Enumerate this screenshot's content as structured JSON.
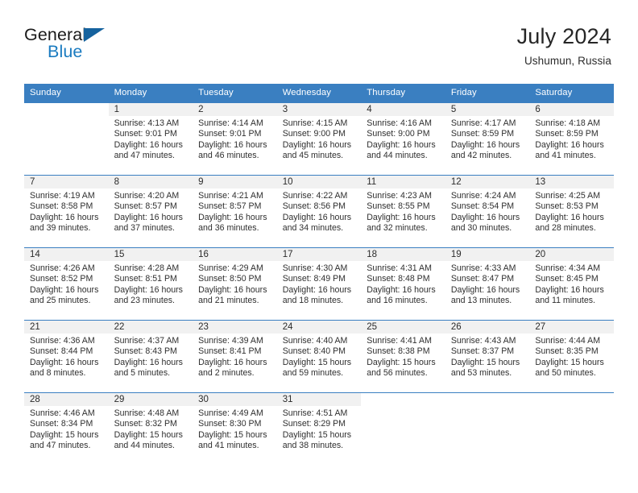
{
  "brand": {
    "word1": "General",
    "word2": "Blue",
    "triangle_color": "#15629E",
    "blue": "#1A7BC0"
  },
  "header": {
    "title": "July 2024",
    "location": "Ushumun, Russia"
  },
  "theme": {
    "header_bg": "#3A7FC1",
    "daynum_band": "#F1F1F1",
    "text": "#2F2F2F"
  },
  "weekday_headers": [
    "Sunday",
    "Monday",
    "Tuesday",
    "Wednesday",
    "Thursday",
    "Friday",
    "Saturday"
  ],
  "labels": {
    "sunrise": "Sunrise:",
    "sunset": "Sunset:",
    "daylight": "Daylight:"
  },
  "weeks": [
    [
      {
        "day": ""
      },
      {
        "day": "1",
        "sunrise": "4:13 AM",
        "sunset": "9:01 PM",
        "daylight": "16 hours and 47 minutes.",
        "info": "Sunrise: 4:13 AM\nSunset: 9:01 PM\nDaylight: 16 hours\nand 47 minutes."
      },
      {
        "day": "2",
        "sunrise": "4:14 AM",
        "sunset": "9:01 PM",
        "daylight": "16 hours and 46 minutes.",
        "info": "Sunrise: 4:14 AM\nSunset: 9:01 PM\nDaylight: 16 hours\nand 46 minutes."
      },
      {
        "day": "3",
        "sunrise": "4:15 AM",
        "sunset": "9:00 PM",
        "daylight": "16 hours and 45 minutes.",
        "info": "Sunrise: 4:15 AM\nSunset: 9:00 PM\nDaylight: 16 hours\nand 45 minutes."
      },
      {
        "day": "4",
        "sunrise": "4:16 AM",
        "sunset": "9:00 PM",
        "daylight": "16 hours and 44 minutes.",
        "info": "Sunrise: 4:16 AM\nSunset: 9:00 PM\nDaylight: 16 hours\nand 44 minutes."
      },
      {
        "day": "5",
        "sunrise": "4:17 AM",
        "sunset": "8:59 PM",
        "daylight": "16 hours and 42 minutes.",
        "info": "Sunrise: 4:17 AM\nSunset: 8:59 PM\nDaylight: 16 hours\nand 42 minutes."
      },
      {
        "day": "6",
        "sunrise": "4:18 AM",
        "sunset": "8:59 PM",
        "daylight": "16 hours and 41 minutes.",
        "info": "Sunrise: 4:18 AM\nSunset: 8:59 PM\nDaylight: 16 hours\nand 41 minutes."
      }
    ],
    [
      {
        "day": "7",
        "sunrise": "4:19 AM",
        "sunset": "8:58 PM",
        "daylight": "16 hours and 39 minutes.",
        "info": "Sunrise: 4:19 AM\nSunset: 8:58 PM\nDaylight: 16 hours\nand 39 minutes."
      },
      {
        "day": "8",
        "sunrise": "4:20 AM",
        "sunset": "8:57 PM",
        "daylight": "16 hours and 37 minutes.",
        "info": "Sunrise: 4:20 AM\nSunset: 8:57 PM\nDaylight: 16 hours\nand 37 minutes."
      },
      {
        "day": "9",
        "sunrise": "4:21 AM",
        "sunset": "8:57 PM",
        "daylight": "16 hours and 36 minutes.",
        "info": "Sunrise: 4:21 AM\nSunset: 8:57 PM\nDaylight: 16 hours\nand 36 minutes."
      },
      {
        "day": "10",
        "sunrise": "4:22 AM",
        "sunset": "8:56 PM",
        "daylight": "16 hours and 34 minutes.",
        "info": "Sunrise: 4:22 AM\nSunset: 8:56 PM\nDaylight: 16 hours\nand 34 minutes."
      },
      {
        "day": "11",
        "sunrise": "4:23 AM",
        "sunset": "8:55 PM",
        "daylight": "16 hours and 32 minutes.",
        "info": "Sunrise: 4:23 AM\nSunset: 8:55 PM\nDaylight: 16 hours\nand 32 minutes."
      },
      {
        "day": "12",
        "sunrise": "4:24 AM",
        "sunset": "8:54 PM",
        "daylight": "16 hours and 30 minutes.",
        "info": "Sunrise: 4:24 AM\nSunset: 8:54 PM\nDaylight: 16 hours\nand 30 minutes."
      },
      {
        "day": "13",
        "sunrise": "4:25 AM",
        "sunset": "8:53 PM",
        "daylight": "16 hours and 28 minutes.",
        "info": "Sunrise: 4:25 AM\nSunset: 8:53 PM\nDaylight: 16 hours\nand 28 minutes."
      }
    ],
    [
      {
        "day": "14",
        "sunrise": "4:26 AM",
        "sunset": "8:52 PM",
        "daylight": "16 hours and 25 minutes.",
        "info": "Sunrise: 4:26 AM\nSunset: 8:52 PM\nDaylight: 16 hours\nand 25 minutes."
      },
      {
        "day": "15",
        "sunrise": "4:28 AM",
        "sunset": "8:51 PM",
        "daylight": "16 hours and 23 minutes.",
        "info": "Sunrise: 4:28 AM\nSunset: 8:51 PM\nDaylight: 16 hours\nand 23 minutes."
      },
      {
        "day": "16",
        "sunrise": "4:29 AM",
        "sunset": "8:50 PM",
        "daylight": "16 hours and 21 minutes.",
        "info": "Sunrise: 4:29 AM\nSunset: 8:50 PM\nDaylight: 16 hours\nand 21 minutes."
      },
      {
        "day": "17",
        "sunrise": "4:30 AM",
        "sunset": "8:49 PM",
        "daylight": "16 hours and 18 minutes.",
        "info": "Sunrise: 4:30 AM\nSunset: 8:49 PM\nDaylight: 16 hours\nand 18 minutes."
      },
      {
        "day": "18",
        "sunrise": "4:31 AM",
        "sunset": "8:48 PM",
        "daylight": "16 hours and 16 minutes.",
        "info": "Sunrise: 4:31 AM\nSunset: 8:48 PM\nDaylight: 16 hours\nand 16 minutes."
      },
      {
        "day": "19",
        "sunrise": "4:33 AM",
        "sunset": "8:47 PM",
        "daylight": "16 hours and 13 minutes.",
        "info": "Sunrise: 4:33 AM\nSunset: 8:47 PM\nDaylight: 16 hours\nand 13 minutes."
      },
      {
        "day": "20",
        "sunrise": "4:34 AM",
        "sunset": "8:45 PM",
        "daylight": "16 hours and 11 minutes.",
        "info": "Sunrise: 4:34 AM\nSunset: 8:45 PM\nDaylight: 16 hours\nand 11 minutes."
      }
    ],
    [
      {
        "day": "21",
        "sunrise": "4:36 AM",
        "sunset": "8:44 PM",
        "daylight": "16 hours and 8 minutes.",
        "info": "Sunrise: 4:36 AM\nSunset: 8:44 PM\nDaylight: 16 hours\nand 8 minutes."
      },
      {
        "day": "22",
        "sunrise": "4:37 AM",
        "sunset": "8:43 PM",
        "daylight": "16 hours and 5 minutes.",
        "info": "Sunrise: 4:37 AM\nSunset: 8:43 PM\nDaylight: 16 hours\nand 5 minutes."
      },
      {
        "day": "23",
        "sunrise": "4:39 AM",
        "sunset": "8:41 PM",
        "daylight": "16 hours and 2 minutes.",
        "info": "Sunrise: 4:39 AM\nSunset: 8:41 PM\nDaylight: 16 hours\nand 2 minutes."
      },
      {
        "day": "24",
        "sunrise": "4:40 AM",
        "sunset": "8:40 PM",
        "daylight": "15 hours and 59 minutes.",
        "info": "Sunrise: 4:40 AM\nSunset: 8:40 PM\nDaylight: 15 hours\nand 59 minutes."
      },
      {
        "day": "25",
        "sunrise": "4:41 AM",
        "sunset": "8:38 PM",
        "daylight": "15 hours and 56 minutes.",
        "info": "Sunrise: 4:41 AM\nSunset: 8:38 PM\nDaylight: 15 hours\nand 56 minutes."
      },
      {
        "day": "26",
        "sunrise": "4:43 AM",
        "sunset": "8:37 PM",
        "daylight": "15 hours and 53 minutes.",
        "info": "Sunrise: 4:43 AM\nSunset: 8:37 PM\nDaylight: 15 hours\nand 53 minutes."
      },
      {
        "day": "27",
        "sunrise": "4:44 AM",
        "sunset": "8:35 PM",
        "daylight": "15 hours and 50 minutes.",
        "info": "Sunrise: 4:44 AM\nSunset: 8:35 PM\nDaylight: 15 hours\nand 50 minutes."
      }
    ],
    [
      {
        "day": "28",
        "sunrise": "4:46 AM",
        "sunset": "8:34 PM",
        "daylight": "15 hours and 47 minutes.",
        "info": "Sunrise: 4:46 AM\nSunset: 8:34 PM\nDaylight: 15 hours\nand 47 minutes."
      },
      {
        "day": "29",
        "sunrise": "4:48 AM",
        "sunset": "8:32 PM",
        "daylight": "15 hours and 44 minutes.",
        "info": "Sunrise: 4:48 AM\nSunset: 8:32 PM\nDaylight: 15 hours\nand 44 minutes."
      },
      {
        "day": "30",
        "sunrise": "4:49 AM",
        "sunset": "8:30 PM",
        "daylight": "15 hours and 41 minutes.",
        "info": "Sunrise: 4:49 AM\nSunset: 8:30 PM\nDaylight: 15 hours\nand 41 minutes."
      },
      {
        "day": "31",
        "sunrise": "4:51 AM",
        "sunset": "8:29 PM",
        "daylight": "15 hours and 38 minutes.",
        "info": "Sunrise: 4:51 AM\nSunset: 8:29 PM\nDaylight: 15 hours\nand 38 minutes."
      },
      {
        "day": ""
      },
      {
        "day": ""
      },
      {
        "day": ""
      }
    ]
  ]
}
